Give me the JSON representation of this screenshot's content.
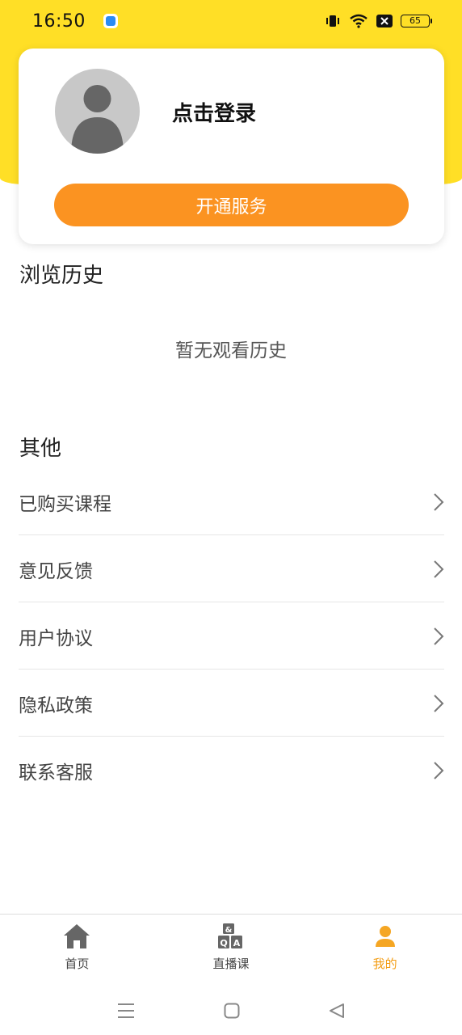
{
  "status": {
    "time": "16:50",
    "battery": "65"
  },
  "profile": {
    "login_text": "点击登录",
    "service_button": "开通服务"
  },
  "history": {
    "title": "浏览历史",
    "empty_text": "暂无观看历史"
  },
  "other": {
    "title": "其他",
    "items": [
      {
        "label": "已购买课程"
      },
      {
        "label": "意见反馈"
      },
      {
        "label": "用户协议"
      },
      {
        "label": "隐私政策"
      },
      {
        "label": "联系客服"
      }
    ]
  },
  "tabs": [
    {
      "label": "首页",
      "icon": "home-icon"
    },
    {
      "label": "直播课",
      "icon": "qa-blocks-icon"
    },
    {
      "label": "我的",
      "icon": "person-icon",
      "active": true
    }
  ],
  "colors": {
    "brand_yellow": "#ffdf26",
    "accent_orange": "#fb9321",
    "active_tab": "#f39c12"
  }
}
